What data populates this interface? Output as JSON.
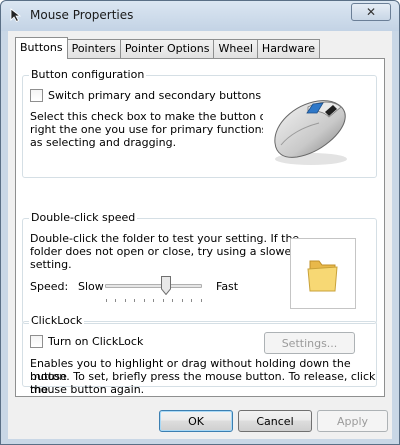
{
  "window": {
    "title": "Mouse Properties",
    "close_glyph": "✕"
  },
  "tabs": [
    {
      "label": "Buttons",
      "active": true
    },
    {
      "label": "Pointers",
      "active": false
    },
    {
      "label": "Pointer Options",
      "active": false
    },
    {
      "label": "Wheel",
      "active": false
    },
    {
      "label": "Hardware",
      "active": false
    }
  ],
  "button_configuration": {
    "title": "Button configuration",
    "checkbox_label": "Switch primary and secondary buttons",
    "checked": false,
    "description_lines": [
      "Select this check box to make the button on the",
      "right the one you use for primary functions such",
      "as selecting and dragging."
    ],
    "icon": "mouse-icon"
  },
  "double_click": {
    "title": "Double-click speed",
    "description_lines": [
      "Double-click the folder to test your setting. If the",
      "folder does not open or close, try using a slower",
      "setting."
    ],
    "speed_label": "Speed:",
    "slow_label": "Slow",
    "fast_label": "Fast",
    "slider_value_fraction": 0.58,
    "test_icon": "folder-icon"
  },
  "clicklock": {
    "title": "ClickLock",
    "checkbox_label": "Turn on ClickLock",
    "checked": false,
    "settings_label": "Settings...",
    "description_lines": [
      "Enables you to highlight or drag without holding down the mouse",
      "button. To set, briefly press the mouse button. To release, click the",
      "mouse button again."
    ]
  },
  "footer": {
    "ok_label": "OK",
    "cancel_label": "Cancel",
    "apply_label": "Apply"
  },
  "colors": {
    "frame": "#c9d7e6",
    "panel": "#ffffff",
    "group_border": "#d5dfe5",
    "accent": "#3c7fb1"
  }
}
